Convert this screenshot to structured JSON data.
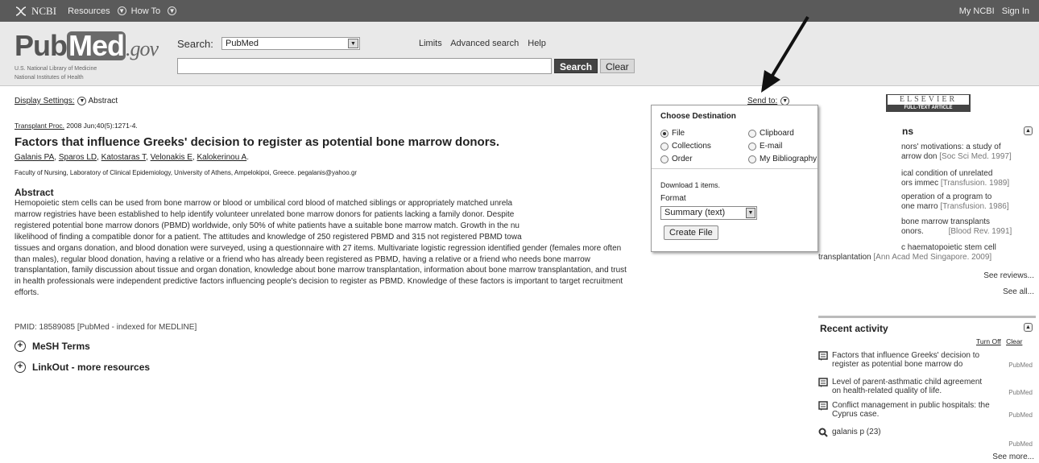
{
  "topbar": {
    "brand": "NCBI",
    "menu": [
      "Resources",
      "How To"
    ],
    "right": [
      "My NCBI",
      "Sign In"
    ]
  },
  "header": {
    "logo_pub": "Pub",
    "logo_med": "Med",
    "logo_gov": ".gov",
    "logo_sub1": "U.S. National Library of Medicine",
    "logo_sub2": "National Institutes of Health",
    "search_label": "Search:",
    "db_value": "PubMed",
    "links": [
      "Limits",
      "Advanced search",
      "Help"
    ],
    "search_value": "",
    "search_button": "Search",
    "clear_button": "Clear"
  },
  "main": {
    "display_settings": "Display Settings:",
    "display_value": "Abstract",
    "send_to": "Send to:",
    "journal": "Transplant Proc.",
    "citation": " 2008 Jun;40(5):1271-4.",
    "title": "Factors that influence Greeks' decision to register as potential bone marrow donors.",
    "authors": [
      "Galanis PA",
      "Sparos LD",
      "Katostaras T",
      "Velonakis E",
      "Kalokerinou A"
    ],
    "affiliation": "Faculty of Nursing, Laboratory of Clinical Epidemiology, University of Athens, Ampelokipoi, Greece. pegalanis@yahoo.gr",
    "abstract_heading": "Abstract",
    "abstract_lines": [
      "Hemopoietic stem cells can be used from bone marrow or blood or umbilical cord blood of matched siblings or appropriately matched unrela",
      "marrow registries have been established to help identify volunteer unrelated bone marrow donors for patients lacking a family donor. Despite",
      "registered potential bone marrow donors (PBMD) worldwide, only 50% of white patients have a suitable bone marrow match. Growth in the nu",
      "likelihood of finding a compatible donor for a patient. The attitudes and knowledge of 250 registered PBMD and 315 not registered PBMD towa",
      "tissues and organs donation, and blood donation were surveyed, using a questionnaire with 27 items. Multivariate logistic regression identified gender (females more often",
      "than males), regular blood donation, having a relative or a friend who has already been registered as PBMD, having a relative or a friend who needs bone marrow",
      "transplantation, family discussion about tissue and organ donation, knowledge about bone marrow transplantation, information about bone marrow transplantation, and trust",
      "in health professionals were independent predictive factors influencing people's decision to register as PBMD. Knowledge of these factors is important to target recruitment",
      "efforts."
    ],
    "pmid": "PMID: 18589085 [PubMed - indexed for MEDLINE]",
    "mesh": "MeSH Terms",
    "linkout": "LinkOut - more resources"
  },
  "popup": {
    "heading": "Choose Destination",
    "options": [
      "File",
      "Clipboard",
      "Collections",
      "E-mail",
      "Order",
      "My Bibliography"
    ],
    "selected": "File",
    "download": "Download 1 items.",
    "format_label": "Format",
    "format_value": "Summary (text)",
    "create_button": "Create File"
  },
  "sidebar": {
    "elsevier": "ELSEVIER",
    "fulltext": "FULL-TEXT ARTICLE",
    "reviews_heading": "ns",
    "reviews": [
      {
        "text": "nors' motivations: a study of",
        "text2": "arrow don",
        "src": "[Soc Sci Med. 1997]"
      },
      {
        "text": "ical condition of unrelated",
        "text2": "ors immec",
        "src": "[Transfusion. 1989]"
      },
      {
        "text": "operation of a program to",
        "text2": "one marro",
        "src": "[Transfusion. 1986]"
      },
      {
        "text": "bone marrow transplants",
        "text2": "onors.",
        "src": "[Blood Rev. 1991]"
      },
      {
        "text": "c haematopoietic stem cell",
        "text2": "transplantation",
        "src": "[Ann Acad Med Singapore. 2009]"
      }
    ],
    "see_reviews": "See reviews...",
    "see_all": "See all...",
    "recent_heading": "Recent activity",
    "turn_off": "Turn Off",
    "clear": "Clear",
    "recent": [
      {
        "l1": "Factors that influence Greeks' decision to",
        "l2": "register as potential bone marrow do",
        "db": "PubMed"
      },
      {
        "l1": "Level of parent-asthmatic child agreement",
        "l2": "on health-related quality of life.",
        "db": "PubMed"
      },
      {
        "l1": "Conflict management in public hospitals: the",
        "l2": "Cyprus case.",
        "db": "PubMed"
      },
      {
        "l1": "galanis p (23)",
        "l2": "",
        "db": "PubMed"
      }
    ],
    "see_more": "See more..."
  }
}
